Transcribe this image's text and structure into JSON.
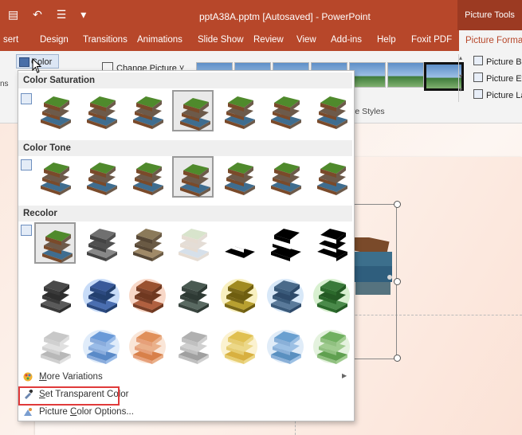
{
  "window": {
    "title": "pptA38A.pptm [Autosaved]  -  PowerPoint",
    "contextual_tab_group": "Picture Tools"
  },
  "tabs": [
    "sert",
    "Design",
    "Transitions",
    "Animations",
    "Slide Show",
    "Review",
    "View",
    "Add-ins",
    "Help",
    "Foxit PDF",
    "Picture Format"
  ],
  "active_tab": "Picture Format",
  "ribbon": {
    "color_button": "Color",
    "change_picture": "Change Picture",
    "right_commands": [
      "Picture Bor",
      "Picture Effe",
      "Picture Lay"
    ],
    "group_label": "ure Styles",
    "left_stub": "ns"
  },
  "color_menu": {
    "sections": [
      {
        "title": "Color Saturation",
        "rows": [
          [
            "natural",
            "natural",
            "natural",
            "natural",
            "natural",
            "natural",
            "natural"
          ]
        ],
        "selected": [
          0,
          3
        ]
      },
      {
        "title": "Color Tone",
        "rows": [
          [
            "natural",
            "natural",
            "natural",
            "natural",
            "natural",
            "natural",
            "natural"
          ]
        ],
        "selected": [
          0,
          3
        ]
      },
      {
        "title": "Recolor",
        "rows": [
          [
            "natural",
            "gray",
            "sepia",
            "washout",
            "bw-light",
            "bw-mid",
            "bw-dark"
          ],
          [
            "dark-gray",
            "dark-blue",
            "dark-orange",
            "dark-green-gray",
            "dark-gold",
            "dark-steel",
            "dark-green"
          ],
          [
            "light-gray",
            "light-blue",
            "light-orange",
            "light-gray2",
            "light-gold",
            "light-steel",
            "light-green"
          ]
        ],
        "selected": [
          0,
          0
        ]
      }
    ],
    "items": [
      {
        "label": "More Variations",
        "underline": "M",
        "rest": "ore Variations",
        "has_submenu": true,
        "icon": "palette-icon"
      },
      {
        "label": "Set Transparent Color",
        "underline": "S",
        "rest": "et Transparent Color",
        "highlighted": true,
        "icon": "eyedropper-icon"
      },
      {
        "label": "Picture Color Options...",
        "underline": "C",
        "pre": "Picture ",
        "rest": "olor Options...",
        "icon": "color-options-icon"
      }
    ]
  },
  "colors": {
    "accent": "#b7472a",
    "highlight_border": "#e03a3a"
  }
}
